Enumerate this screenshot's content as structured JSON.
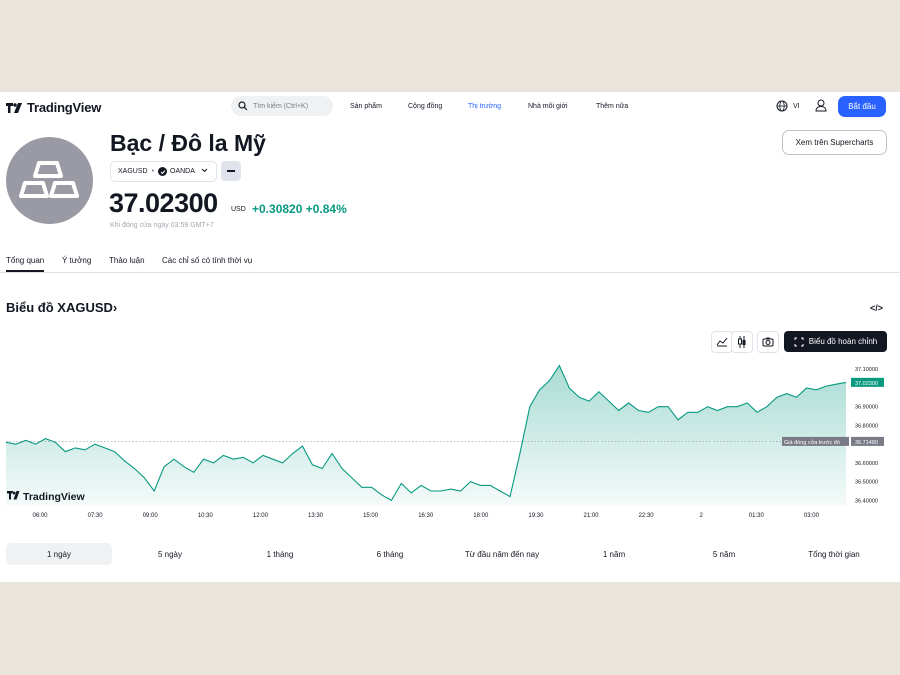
{
  "header": {
    "logo": "TradingView",
    "search_placeholder": "Tìm kiếm (Ctrl+K)",
    "nav": [
      "Sản phẩm",
      "Cộng đồng",
      "Thị trường",
      "Nhà môi giới",
      "Thêm nữa"
    ],
    "active_nav": "Thị trường",
    "lang": "VI",
    "start_button": "Bắt đầu"
  },
  "symbol": {
    "title": "Bạc / Đô la Mỹ",
    "ticker": "XAGUSD",
    "exchange": "OANDA",
    "price": "37.02300",
    "currency": "USD",
    "change": "+0.30820",
    "change_pct": "+0.84%",
    "note": "Khi đóng cửa ngày 03:59 GMT+7",
    "supercharts_button": "Xem trên Supercharts"
  },
  "tabs": [
    "Tổng quan",
    "Ý tưởng",
    "Thảo luận",
    "Các chỉ số có tính thời vụ"
  ],
  "active_tab": "Tổng quan",
  "chart_section": {
    "title": "Biểu đồ XAGUSD",
    "embed_icon": "</>",
    "full_chart_button": "Biểu đồ hoàn chỉnh",
    "watermark": "TradingView",
    "prev_close_label": "Giá đóng cửa trước đó",
    "prev_close_value": "36.71480",
    "last_value": "37.02300"
  },
  "chart_data": {
    "type": "area",
    "x_ticks": [
      "06:00",
      "07:30",
      "09:00",
      "10:30",
      "12:00",
      "13:30",
      "15:00",
      "16:30",
      "18:00",
      "19:30",
      "21:00",
      "22:30",
      "2",
      "01:30",
      "03:00"
    ],
    "y_ticks": [
      "37.10000",
      "36.90000",
      "36.80000",
      "36.60000",
      "36.50000",
      "36.40000"
    ],
    "ylim": [
      36.37,
      37.16
    ],
    "line_color": "#089981",
    "fill_color": "#089981",
    "prev_close": 36.7148,
    "series": [
      {
        "values": [
          36.71,
          36.7,
          36.72,
          36.7,
          36.73,
          36.71,
          36.66,
          36.68,
          36.67,
          36.7,
          36.68,
          36.66,
          36.61,
          36.57,
          36.52,
          36.45,
          36.58,
          36.62,
          36.58,
          36.55,
          36.62,
          36.6,
          36.64,
          36.62,
          36.63,
          36.6,
          36.64,
          36.62,
          36.6,
          36.65,
          36.69,
          36.59,
          36.57,
          36.65,
          36.57,
          36.52,
          36.47,
          36.47,
          36.43,
          36.4,
          36.49,
          36.44,
          36.48,
          36.45,
          36.45,
          36.46,
          36.45,
          36.5,
          36.48,
          36.48,
          36.45,
          36.42,
          36.65,
          36.9,
          36.99,
          37.04,
          37.12,
          37.0,
          36.95,
          36.93,
          36.98,
          36.93,
          36.88,
          36.92,
          36.88,
          36.87,
          36.9,
          36.9,
          36.83,
          36.87,
          36.87,
          36.9,
          36.88,
          36.9,
          36.9,
          36.92,
          36.87,
          36.9,
          36.95,
          36.97,
          36.95,
          37.0,
          36.99,
          37.01,
          37.02,
          37.03
        ]
      }
    ]
  },
  "ranges": [
    "1 ngày",
    "5 ngày",
    "1 tháng",
    "6 tháng",
    "Từ đầu năm đến nay",
    "1 năm",
    "5 năm",
    "Tổng thời gian"
  ],
  "active_range": "1 ngày"
}
